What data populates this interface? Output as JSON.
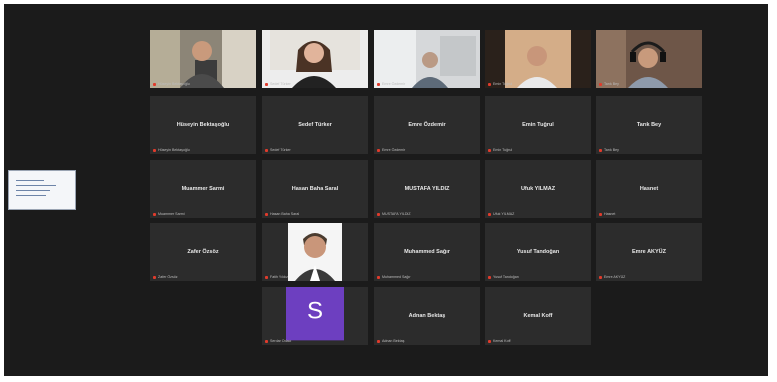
{
  "shared_screen": {
    "label": "shared screen"
  },
  "tiles": [
    {
      "id": "t1",
      "name": "",
      "label": "Hüseyin Bektaşoğlu",
      "video": true,
      "icon": "person-video-1"
    },
    {
      "id": "t2",
      "name": "",
      "label": "Sedef Türker",
      "video": true,
      "icon": "person-video-2"
    },
    {
      "id": "t3",
      "name": "",
      "label": "Emre Özdemir",
      "video": true,
      "icon": "person-video-3"
    },
    {
      "id": "t4",
      "name": "",
      "label": "Emin Tuğrul",
      "video": true,
      "icon": "person-video-4"
    },
    {
      "id": "t5",
      "name": "",
      "label": "Tarık Bey",
      "video": true,
      "active": true,
      "icon": "person-video-5"
    },
    {
      "id": "t6",
      "name": "Hüseyin Bektaşoğlu",
      "label": "Hüseyin Bektaşoğlu"
    },
    {
      "id": "t7",
      "name": "Sedef Türker",
      "label": "Sedef Türker"
    },
    {
      "id": "t8",
      "name": "Emre Özdemir",
      "label": "Emre Özdemir"
    },
    {
      "id": "t9",
      "name": "Emin Tuğrul",
      "label": "Emin Tuğrul"
    },
    {
      "id": "t10",
      "name": "Tarık Bey",
      "label": "Tarık Bey"
    },
    {
      "id": "t11",
      "name": "Muammer Sarmi",
      "label": "Muammer Sarmi"
    },
    {
      "id": "t12",
      "name": "Hasan Baha Saral",
      "label": "Hasan Baha Saral"
    },
    {
      "id": "t13",
      "name": "MUSTAFA YILDIZ",
      "label": "MUSTAFA YILDIZ"
    },
    {
      "id": "t14",
      "name": "Ufuk YILMAZ",
      "label": "Ufuk YILMAZ"
    },
    {
      "id": "t15",
      "name": "Hasnet",
      "label": "Hasnet"
    },
    {
      "id": "t16",
      "name": "Zafer Özsöz",
      "label": "Zafer Özsöz"
    },
    {
      "id": "t17",
      "name": "",
      "label": "Fatih Yıldız",
      "video": true,
      "icon": "person-video-6"
    },
    {
      "id": "t18",
      "name": "Muhammed Sağır",
      "label": "Muhammed Sağır"
    },
    {
      "id": "t19",
      "name": "Yusuf Tandoğan",
      "label": "Yusuf Tandoğan"
    },
    {
      "id": "t20",
      "name": "Emre AKYÜZ",
      "label": "Emre AKYÜZ"
    },
    {
      "id": "t21",
      "name": "",
      "label": "Serdar Odacı",
      "avatar": "S",
      "icon": "avatar-s"
    },
    {
      "id": "t22",
      "name": "Adnan Bektaş",
      "label": "Adnan Bektaş"
    },
    {
      "id": "t23",
      "name": "Kemal Koff",
      "label": "Kemal Koff"
    }
  ],
  "colors": {
    "bg": "#1b1b1b",
    "tile": "#2c2c2c",
    "active": "#b9cf4b",
    "mic": "#e03b2c",
    "avatar": "#6d3fc0"
  }
}
